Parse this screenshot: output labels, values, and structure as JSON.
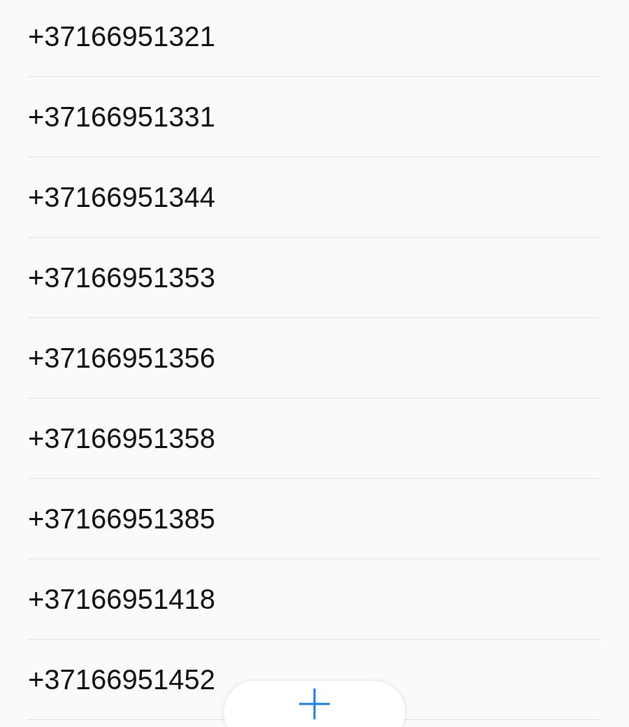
{
  "phone_numbers": [
    "+37166951321",
    "+37166951331",
    "+37166951344",
    "+37166951353",
    "+37166951356",
    "+37166951358",
    "+37166951385",
    "+37166951418",
    "+37166951452"
  ]
}
